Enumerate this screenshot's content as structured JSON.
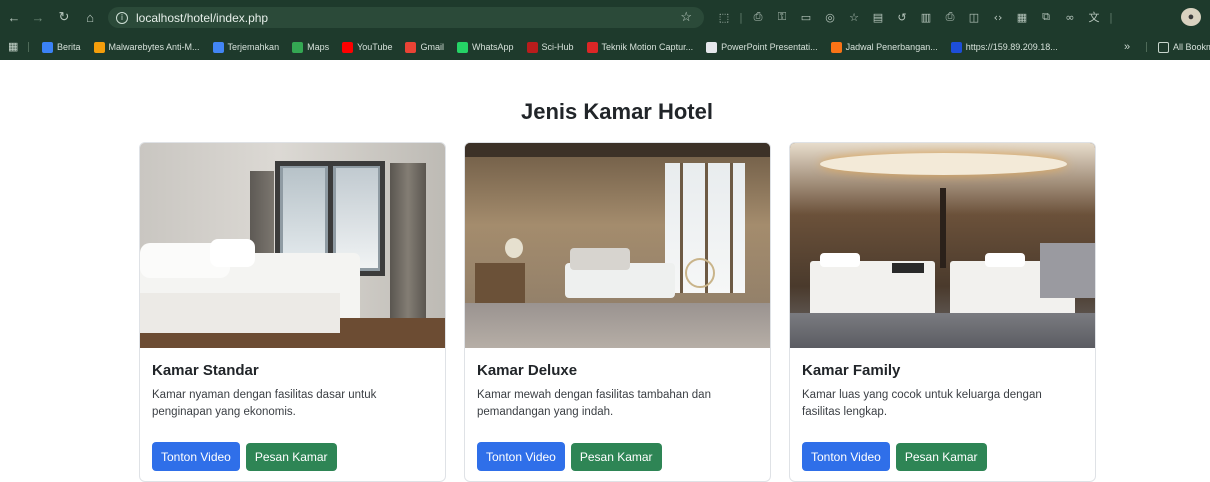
{
  "browser": {
    "url": "localhost/hotel/index.php",
    "bookmarks": [
      {
        "label": "Berita",
        "color": "#3b82f6",
        "icon": "news-icon"
      },
      {
        "label": "Malwarebytes Anti-M...",
        "color": "#f59e0b",
        "icon": "malwarebytes-icon"
      },
      {
        "label": "Terjemahkan",
        "color": "#4285f4",
        "icon": "translate-icon"
      },
      {
        "label": "Maps",
        "color": "#34a853",
        "icon": "maps-icon"
      },
      {
        "label": "YouTube",
        "color": "#ff0000",
        "icon": "youtube-icon"
      },
      {
        "label": "Gmail",
        "color": "#ea4335",
        "icon": "gmail-icon"
      },
      {
        "label": "WhatsApp",
        "color": "#25d366",
        "icon": "whatsapp-icon"
      },
      {
        "label": "Sci-Hub",
        "color": "#b91c1c",
        "icon": "scihub-icon"
      },
      {
        "label": "Teknik Motion Captur...",
        "color": "#dc2626",
        "icon": "page-icon"
      },
      {
        "label": "PowerPoint Presentati...",
        "color": "#e5e7eb",
        "icon": "globe-icon"
      },
      {
        "label": "Jadwal Penerbangan...",
        "color": "#f97316",
        "icon": "flight-icon"
      },
      {
        "label": "https://159.89.209.18...",
        "color": "#1d4ed8",
        "icon": "site-icon"
      }
    ],
    "more_label": "»",
    "all_bookmarks_label": "All Bookm"
  },
  "page": {
    "title": "Jenis Kamar Hotel"
  },
  "rooms": [
    {
      "title": "Kamar Standar",
      "description": "Kamar nyaman dengan fasilitas dasar untuk penginapan yang ekonomis.",
      "video_label": "Tonton Video",
      "book_label": "Pesan Kamar"
    },
    {
      "title": "Kamar Deluxe",
      "description": "Kamar mewah dengan fasilitas tambahan dan pemandangan yang indah.",
      "video_label": "Tonton Video",
      "book_label": "Pesan Kamar"
    },
    {
      "title": "Kamar Family",
      "description": "Kamar luas yang cocok untuk keluarga dengan fasilitas lengkap.",
      "video_label": "Tonton Video",
      "book_label": "Pesan Kamar"
    }
  ],
  "colors": {
    "chrome": "#1e3a2c",
    "primary_button": "#2f6fe9",
    "success_button": "#2e8555"
  }
}
